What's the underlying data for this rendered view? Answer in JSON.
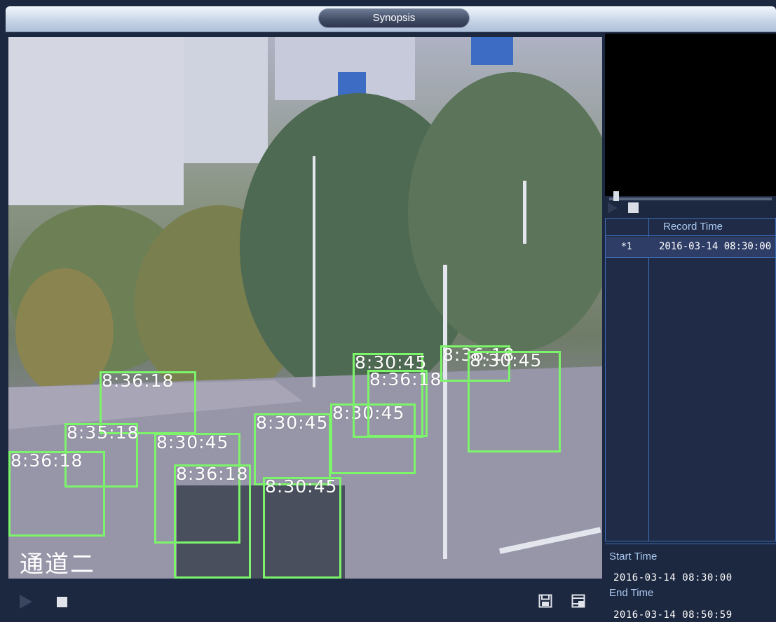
{
  "window": {
    "title": "Synopsis"
  },
  "video": {
    "channel_osd": "通道二",
    "detections": [
      {
        "label": "8:36:18"
      },
      {
        "label": "8:35:18"
      },
      {
        "label": "8:36:18"
      },
      {
        "label": "8:30:45"
      },
      {
        "label": "8:36:18"
      },
      {
        "label": "8:30:45"
      },
      {
        "label": "8:30:45"
      },
      {
        "label": "8:30:45"
      },
      {
        "label": "8:36:18"
      },
      {
        "label": "8:30:45"
      },
      {
        "label": "8:36:18"
      },
      {
        "label": "8:30:45"
      }
    ]
  },
  "controls": {
    "play_icon": "play-icon",
    "stop_icon": "stop-icon",
    "save_icon": "save-icon",
    "clip_icon": "clip-icon"
  },
  "record_list": {
    "header": "Record Time",
    "rows": [
      {
        "index": "*1",
        "time": "2016-03-14 08:30:00"
      }
    ]
  },
  "time_panel": {
    "start_label": "Start Time",
    "start_value": "2016-03-14 08:30:00",
    "end_label": "End Time",
    "end_value": "2016-03-14 08:50:59"
  },
  "colors": {
    "accent": "#3e6fb8",
    "detection_box": "#7cf56a",
    "panel_bg": "#1c2740"
  }
}
